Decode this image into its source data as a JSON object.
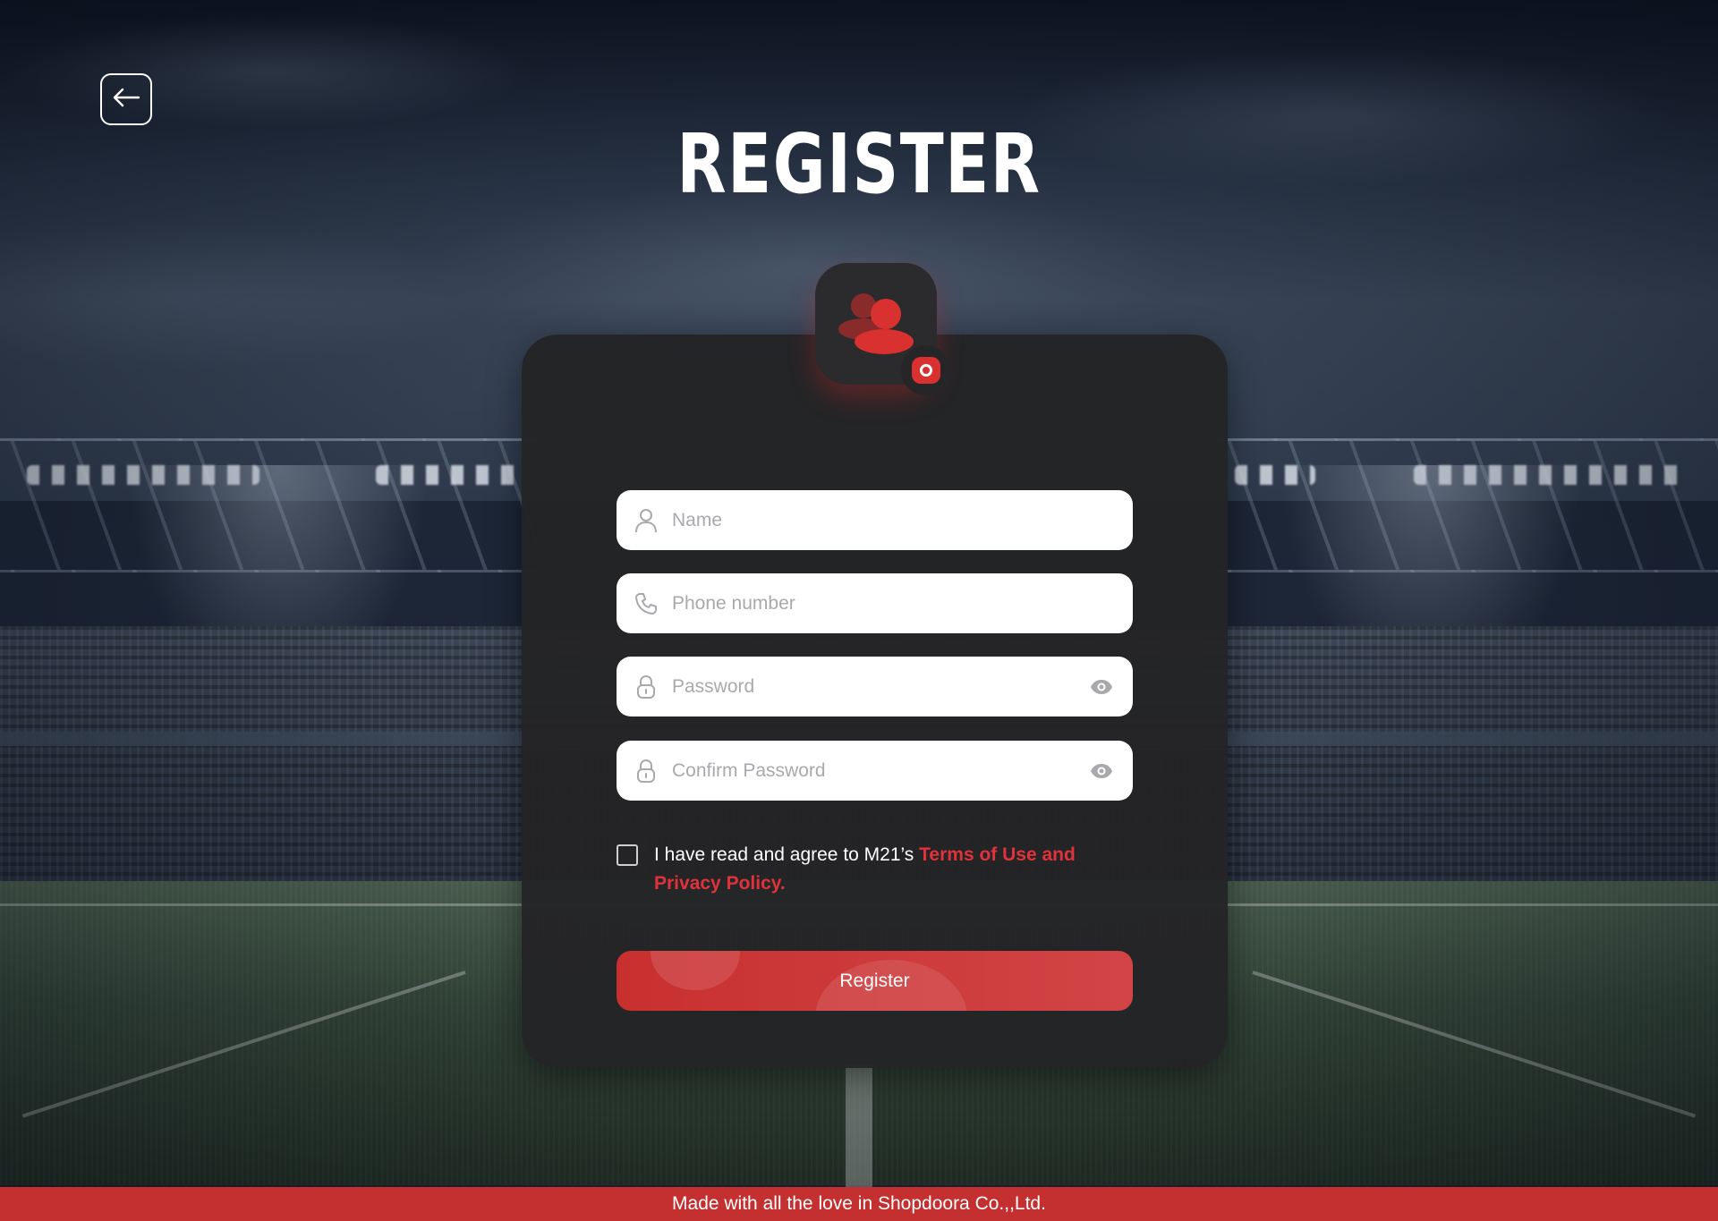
{
  "page": {
    "title": "REGISTER"
  },
  "form": {
    "name_placeholder": "Name",
    "phone_placeholder": "Phone number",
    "password_placeholder": "Password",
    "confirm_password_placeholder": "Confirm Password"
  },
  "agreement": {
    "checked": false,
    "prefix": "I have read and agree to M21’s ",
    "link_text": "Terms of Use and Privacy Policy."
  },
  "actions": {
    "register_label": "Register"
  },
  "footer": {
    "text": "Made with all the love in Shopdoora Co.,,Ltd."
  },
  "icons": {
    "back": "arrow-left-icon",
    "avatar": "users-icon",
    "camera": "camera-icon",
    "name": "user-icon",
    "phone": "phone-icon",
    "lock": "lock-icon",
    "eye": "eye-icon"
  },
  "colors": {
    "accent": "#d93030",
    "footer": "#c42f2f",
    "card": "#242426",
    "input_bg": "#ffffff",
    "placeholder": "#a9a9ad"
  }
}
